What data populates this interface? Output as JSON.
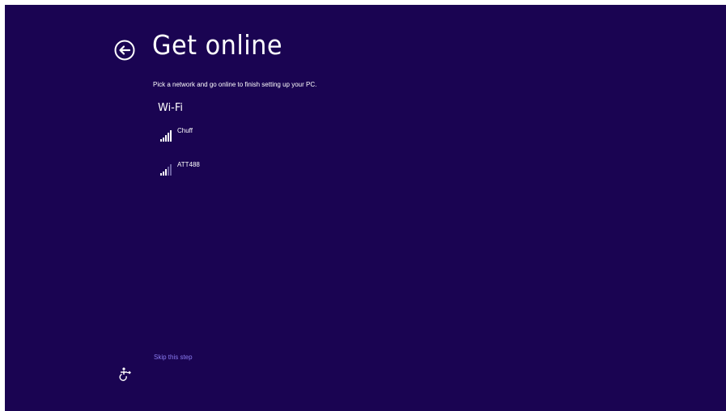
{
  "page": {
    "title": "Get online",
    "subtitle": "Pick a network and go online to finish setting up your PC."
  },
  "wifi": {
    "heading": "Wi-Fi",
    "networks": [
      {
        "name": "Chuff",
        "signal_bars": 5,
        "signal_icon": "wifi-signal-icon"
      },
      {
        "name": "ATT488",
        "signal_bars": 3,
        "signal_icon": "wifi-signal-icon"
      }
    ]
  },
  "footer": {
    "skip_label": "Skip this step",
    "ease_icon": "ease-of-access-icon"
  },
  "nav": {
    "back_icon": "back-arrow-icon"
  },
  "colors": {
    "background": "#1a0452",
    "text": "#ffffff",
    "link": "#8a7bf0",
    "dim_bar": "#6b5fa0"
  }
}
